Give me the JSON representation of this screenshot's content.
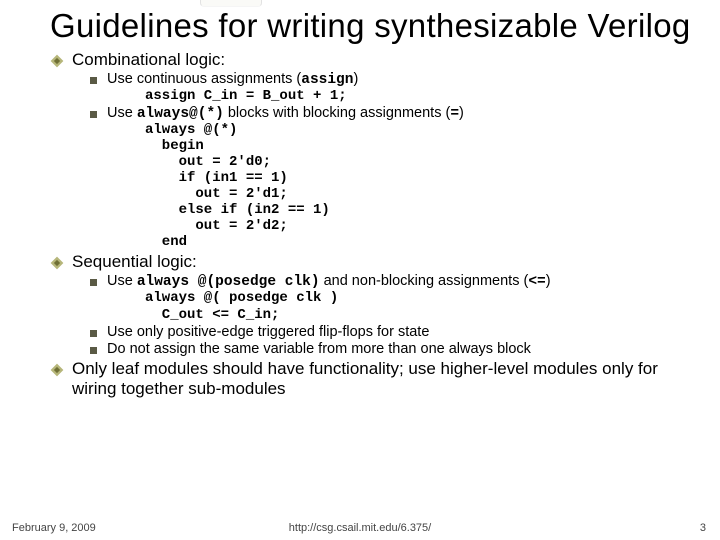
{
  "title": "Guidelines for writing synthesizable Verilog",
  "sec1": {
    "heading": "Combinational logic:",
    "item1_a": "Use continuous assignments (",
    "item1_b": "assign",
    "item1_c": ")",
    "code1": "assign C_in = B_out + 1;",
    "item2_a": "Use ",
    "item2_b": "always@(*)",
    "item2_c": " blocks with blocking assignments (",
    "item2_d": "=",
    "item2_e": ")",
    "code2": "always @(*)\n  begin\n    out = 2'd0;\n    if (in1 == 1)\n      out = 2'd1;\n    else if (in2 == 1)\n      out = 2'd2;\n  end"
  },
  "sec2": {
    "heading": "Sequential logic:",
    "item1_a": "Use ",
    "item1_b": "always @(posedge clk)",
    "item1_c": " and non-blocking assignments (",
    "item1_d": "<=",
    "item1_e": ")",
    "code1": "always @( posedge clk )\n  C_out <= C_in;",
    "item2": "Use only positive-edge triggered flip-flops for state",
    "item3": "Do not assign the same variable from more than one always block"
  },
  "sec3": "Only leaf modules should have functionality; use higher-level modules only for wiring together sub-modules",
  "footer": {
    "date": "February 9, 2009",
    "url": "http://csg.csail.mit.edu/6.375/",
    "pagenum": "3"
  }
}
